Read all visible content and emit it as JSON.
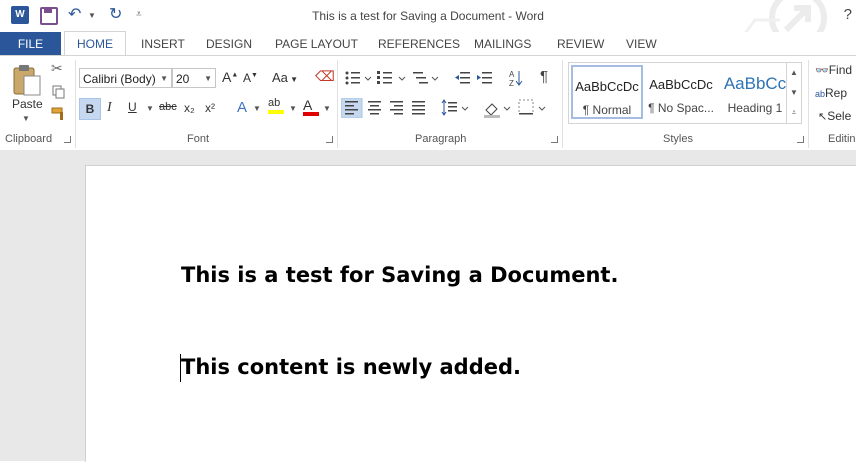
{
  "titlebar": {
    "title": "This is a test for Saving a Document - Word",
    "app_icon_letter": "W",
    "help": "?"
  },
  "tabs": {
    "file": "FILE",
    "items": [
      "HOME",
      "INSERT",
      "DESIGN",
      "PAGE LAYOUT",
      "REFERENCES",
      "MAILINGS",
      "REVIEW",
      "VIEW"
    ],
    "active": "HOME"
  },
  "ribbon": {
    "clipboard": {
      "label": "Clipboard",
      "paste": "Paste"
    },
    "font": {
      "label": "Font",
      "font_name": "Calibri (Body)",
      "font_size": "20",
      "bold": "B",
      "italic": "I",
      "underline": "U",
      "strike": "abc",
      "subscript": "x₂",
      "superscript": "x²",
      "change_case": "Aa",
      "text_effects": "A",
      "highlight": "ab",
      "font_color": "A",
      "grow": "A",
      "shrink": "A",
      "highlight_color": "#ffff00",
      "font_color_value": "#e00000"
    },
    "paragraph": {
      "label": "Paragraph",
      "pilcrow": "¶"
    },
    "styles": {
      "label": "Styles",
      "items": [
        {
          "sample": "AaBbCcDc",
          "name": "¶ Normal"
        },
        {
          "sample": "AaBbCcDc",
          "name": "¶ No Spac..."
        },
        {
          "sample": "AaBbCc",
          "name": "Heading 1"
        }
      ]
    },
    "editing": {
      "label": "Editin",
      "find": "Find",
      "replace": "Rep",
      "select": "Sele"
    }
  },
  "document": {
    "line1": "This is a test for Saving a Document.",
    "line2": "This content is newly added."
  },
  "colors": {
    "accent": "#2b579a"
  }
}
